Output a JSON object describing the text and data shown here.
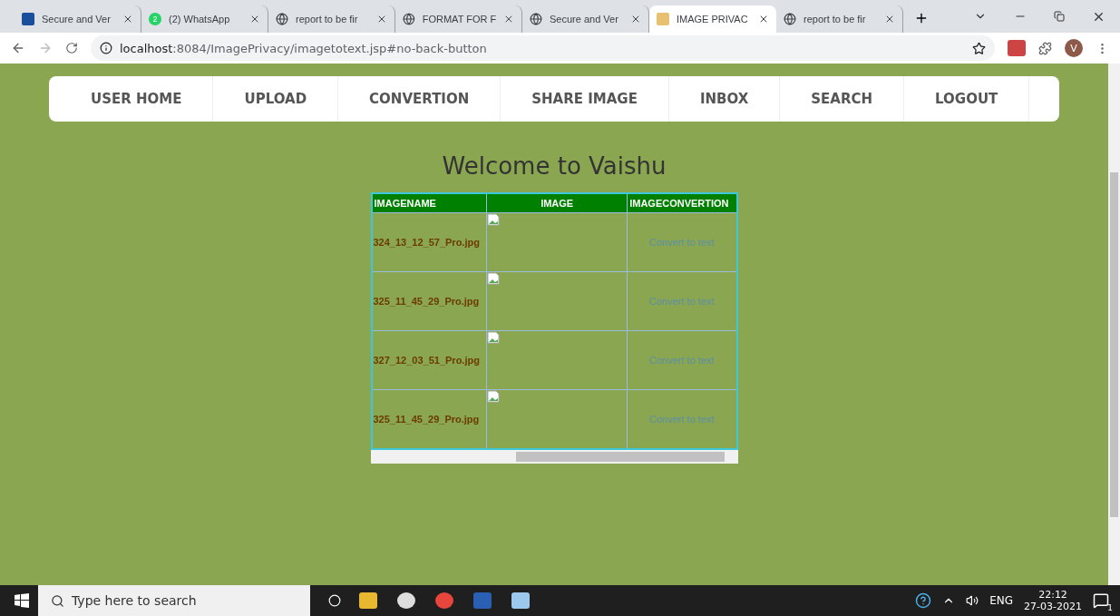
{
  "browser": {
    "tabs": [
      {
        "title": "Secure and Ver",
        "kind": "ieee",
        "selected": false
      },
      {
        "title": "(2) WhatsApp",
        "kind": "chat",
        "selected": false
      },
      {
        "title": "report to be fir",
        "kind": "web",
        "selected": false
      },
      {
        "title": "FORMAT FOR F",
        "kind": "web",
        "selected": false
      },
      {
        "title": "Secure and Ver",
        "kind": "web",
        "selected": false
      },
      {
        "title": "IMAGE PRIVAC",
        "kind": "cat",
        "selected": true
      },
      {
        "title": "report to be fir",
        "kind": "web",
        "selected": false
      }
    ],
    "badge": "2",
    "avatar": "V",
    "url_host": "localhost",
    "url_rest": ":8084/ImagePrivacy/imagetotext.jsp#no-back-button"
  },
  "nav": [
    {
      "label": "USER HOME"
    },
    {
      "label": "UPLOAD"
    },
    {
      "label": "CONVERTION"
    },
    {
      "label": "SHARE IMAGE"
    },
    {
      "label": "INBOX"
    },
    {
      "label": "SEARCH"
    },
    {
      "label": "LOGOUT"
    }
  ],
  "heading": "Welcome to Vaishu",
  "table": {
    "columns": [
      "IMAGENAME",
      "IMAGE",
      "IMAGECONVERTION"
    ],
    "rows": [
      {
        "name": "324_13_12_57_Pro.jpg",
        "action": "Convert to text"
      },
      {
        "name": "325_11_45_29_Pro.jpg",
        "action": "Convert to text"
      },
      {
        "name": "327_12_03_51_Pro.jpg",
        "action": "Convert to text"
      },
      {
        "name": "325_11_45_29_Pro.jpg",
        "action": "Convert to text"
      }
    ]
  },
  "taskbar": {
    "search_placeholder": "Type here to search",
    "lang": "ENG",
    "time": "22:12",
    "date": "27-03-2021",
    "notifications": "1"
  }
}
